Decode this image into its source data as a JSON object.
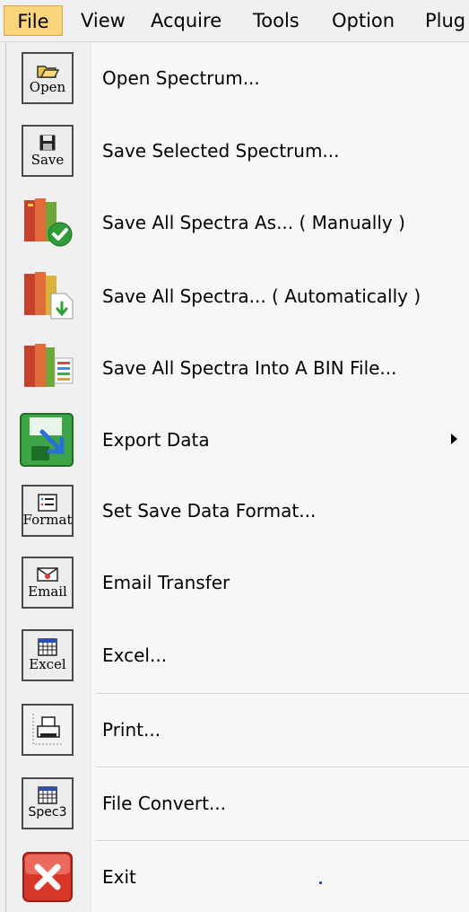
{
  "menubar": {
    "items": [
      "File",
      "View",
      "Acquire",
      "Tools",
      "Option",
      "Plug"
    ]
  },
  "file_menu": {
    "items": [
      {
        "label": "Open Spectrum...",
        "icon": "open-folder-icon",
        "icon_caption": "Open"
      },
      {
        "label": "Save Selected Spectrum...",
        "icon": "save-disk-icon",
        "icon_caption": "Save"
      },
      {
        "label": "Save All Spectra As... ( Manually )",
        "icon": "books-checkmark-icon"
      },
      {
        "label": "Save All Spectra... ( Automatically )",
        "icon": "books-download-icon"
      },
      {
        "label": "Save All Spectra Into A BIN File...",
        "icon": "books-list-icon"
      },
      {
        "label": "Export Data",
        "icon": "export-disk-icon",
        "has_submenu": true
      },
      {
        "label": "Set Save Data Format...",
        "icon": "format-list-icon",
        "icon_caption": "Format"
      },
      {
        "label": "Email Transfer",
        "icon": "email-envelope-icon",
        "icon_caption": "Email"
      },
      {
        "label": "Excel...",
        "icon": "excel-grid-icon",
        "icon_caption": "Excel"
      },
      {
        "label": "Print...",
        "icon": "printer-icon"
      },
      {
        "label": "File Convert...",
        "icon": "spec3-grid-icon",
        "icon_caption": "Spec3"
      },
      {
        "label": "Exit",
        "icon": "exit-x-icon"
      }
    ]
  },
  "colors": {
    "active_menu_bg": "#fbd57c",
    "active_menu_border": "#e3a33a",
    "menu_bg": "#f7f7f7",
    "exit_red": "#d9362a",
    "check_green": "#2f9e3a"
  }
}
